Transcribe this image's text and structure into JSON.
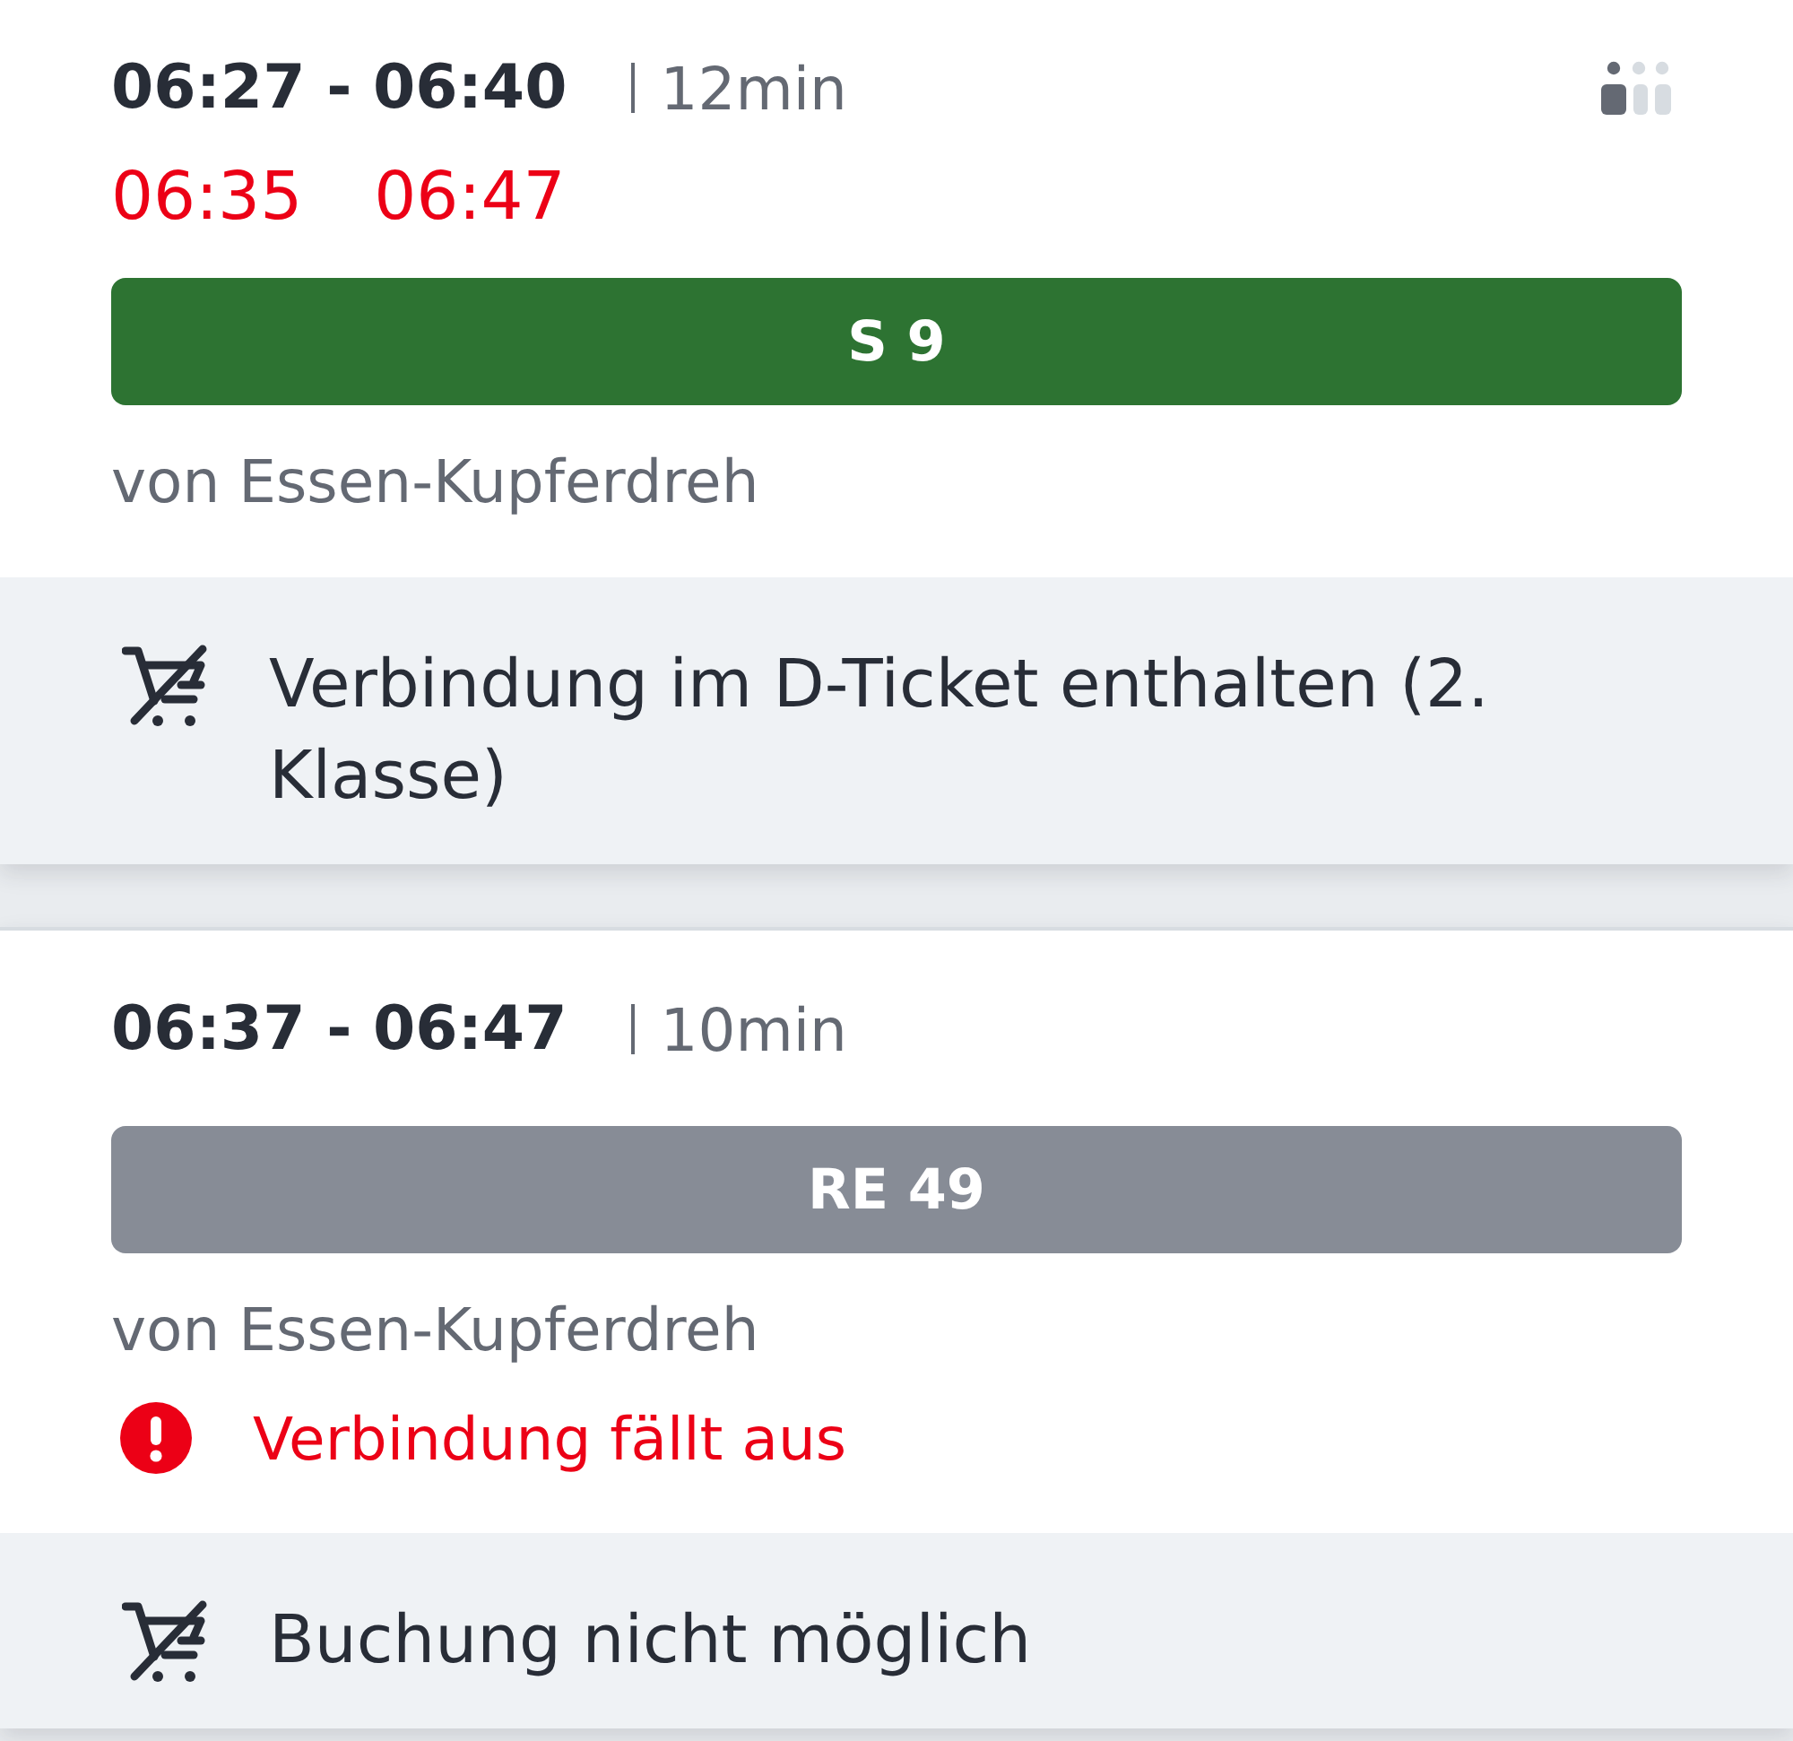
{
  "connections": [
    {
      "planned_time": "06:27 - 06:40",
      "duration": "12min",
      "occupancy": {
        "level": 0.33
      },
      "realtime": {
        "departure": "06:35",
        "arrival": "06:47"
      },
      "line": {
        "label": "S 9",
        "color": "#2d7332"
      },
      "origin": "von Essen-Kupferdreh",
      "ticket_info": "Verbindung im D-Ticket enthalten (2. Klasse)"
    },
    {
      "planned_time": "06:37 - 06:47",
      "duration": "10min",
      "line": {
        "label": "RE 49",
        "color": "#878c96"
      },
      "origin": "von Essen-Kupferdreh",
      "notice": {
        "kind": "error",
        "text": "Verbindung fällt aus"
      },
      "ticket_info": "Buchung nicht möglich"
    }
  ]
}
